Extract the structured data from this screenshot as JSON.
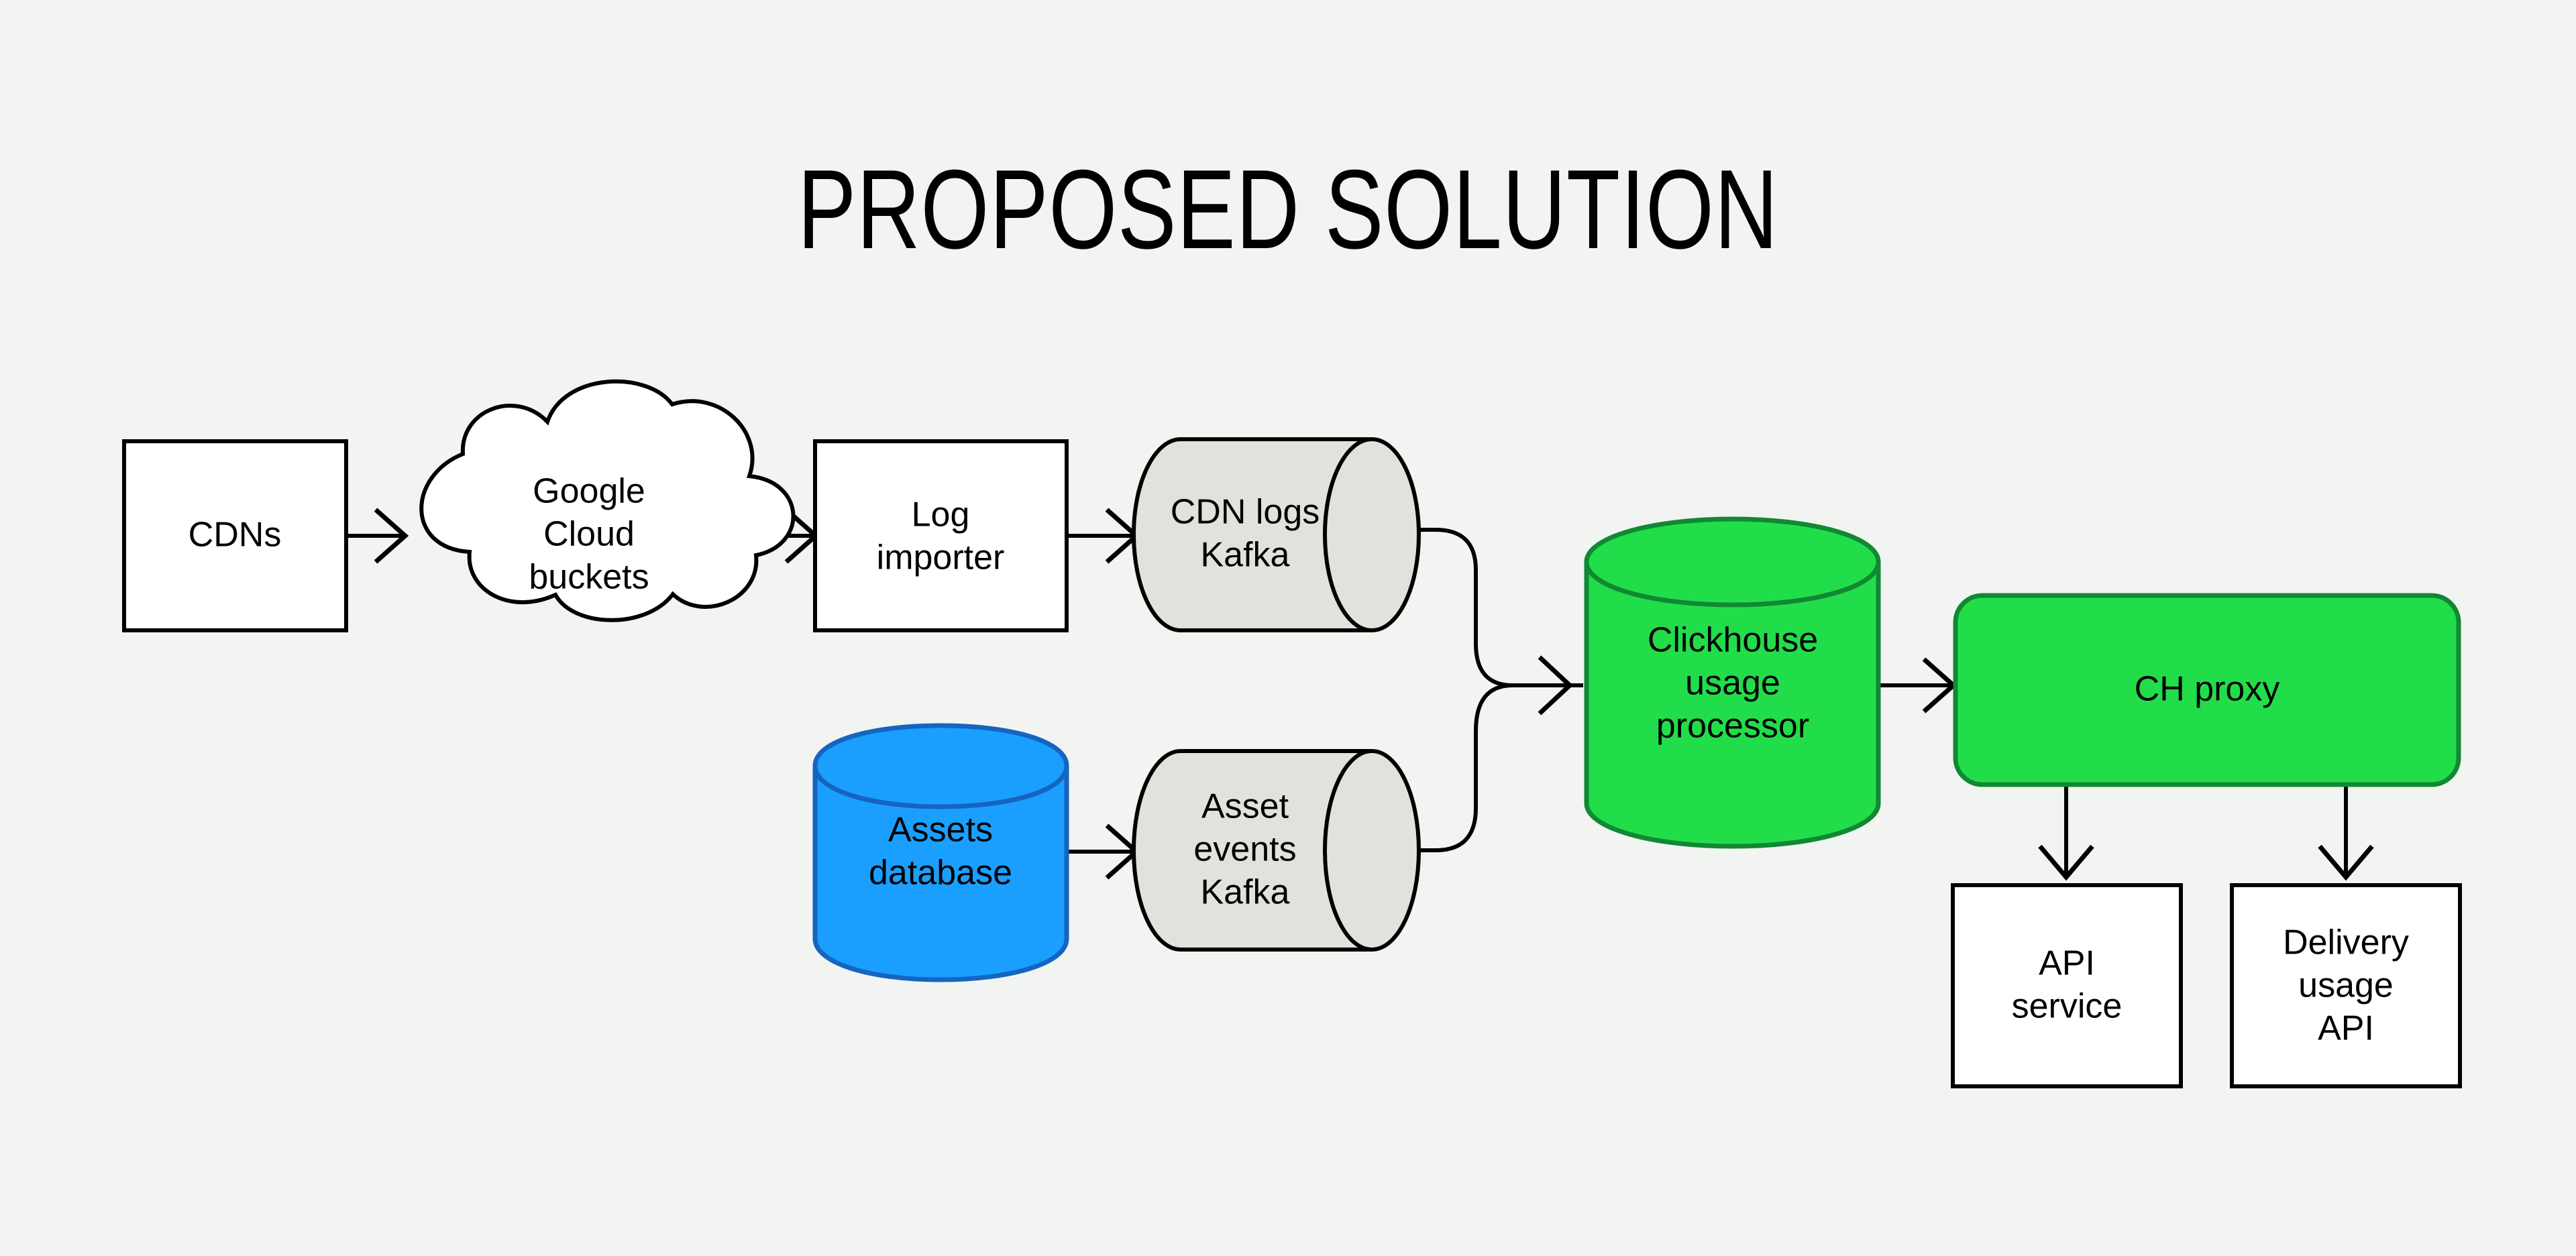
{
  "title": "PROPOSED SOLUTION",
  "colors": {
    "background": "#f2f4f1",
    "white_fill": "#ffffff",
    "kafka_fill": "#e2e2dd",
    "blue_fill": "#1a9fff",
    "blue_stroke": "#1565c0",
    "green_fill": "#22dd4a",
    "green_stroke": "#118833",
    "stroke_black": "#000000",
    "text": "#000000"
  },
  "nodes": [
    {
      "id": "cdns",
      "label": "CDNs",
      "shape": "rectangle"
    },
    {
      "id": "gcs",
      "label": "Google\nCloud\nbuckets",
      "shape": "cloud"
    },
    {
      "id": "log_importer",
      "label": "Log\nimporter",
      "shape": "rectangle"
    },
    {
      "id": "cdn_kafka",
      "label": "CDN logs\nKafka",
      "shape": "cylinder-horizontal"
    },
    {
      "id": "assets_db",
      "label": "Assets\ndatabase",
      "shape": "cylinder-vertical"
    },
    {
      "id": "asset_kafka",
      "label": "Asset\nevents\nKafka",
      "shape": "cylinder-horizontal"
    },
    {
      "id": "ch_processor",
      "label": "Clickhouse\nusage\nprocessor",
      "shape": "cylinder-vertical"
    },
    {
      "id": "ch_proxy",
      "label": "CH proxy",
      "shape": "rounded-rectangle"
    },
    {
      "id": "api_service",
      "label": "API\nservice",
      "shape": "rectangle"
    },
    {
      "id": "delivery_api",
      "label": "Delivery\nusage\nAPI",
      "shape": "rectangle"
    }
  ],
  "node_labels": {
    "cdns": "CDNs",
    "gcs_line1": "Google",
    "gcs_line2": "Cloud",
    "gcs_line3": "buckets",
    "log_importer_line1": "Log",
    "log_importer_line2": "importer",
    "cdn_kafka_line1": "CDN logs",
    "cdn_kafka_line2": "Kafka",
    "assets_db_line1": "Assets",
    "assets_db_line2": "database",
    "asset_kafka_line1": "Asset",
    "asset_kafka_line2": "events",
    "asset_kafka_line3": "Kafka",
    "ch_processor_line1": "Clickhouse",
    "ch_processor_line2": "usage",
    "ch_processor_line3": "processor",
    "ch_proxy": "CH proxy",
    "api_service_line1": "API",
    "api_service_line2": "service",
    "delivery_api_line1": "Delivery",
    "delivery_api_line2": "usage",
    "delivery_api_line3": "API"
  },
  "edges": [
    {
      "id": "e1",
      "from": "cdns",
      "to": "gcs",
      "style": "straight-arrow"
    },
    {
      "id": "e2",
      "from": "gcs",
      "to": "log_importer",
      "style": "straight-arrow"
    },
    {
      "id": "e3",
      "from": "log_importer",
      "to": "cdn_kafka",
      "style": "straight-arrow"
    },
    {
      "id": "e4",
      "from": "cdn_kafka",
      "to": "ch_processor",
      "style": "curved-merge-arrow"
    },
    {
      "id": "e5",
      "from": "assets_db",
      "to": "asset_kafka",
      "style": "straight-arrow"
    },
    {
      "id": "e6",
      "from": "asset_kafka",
      "to": "ch_processor",
      "style": "curved-merge-arrow"
    },
    {
      "id": "e7",
      "from": "ch_processor",
      "to": "ch_proxy",
      "style": "straight-arrow"
    },
    {
      "id": "e8",
      "from": "ch_proxy",
      "to": "api_service",
      "style": "down-arrow"
    },
    {
      "id": "e9",
      "from": "ch_proxy",
      "to": "delivery_api",
      "style": "down-arrow"
    }
  ]
}
